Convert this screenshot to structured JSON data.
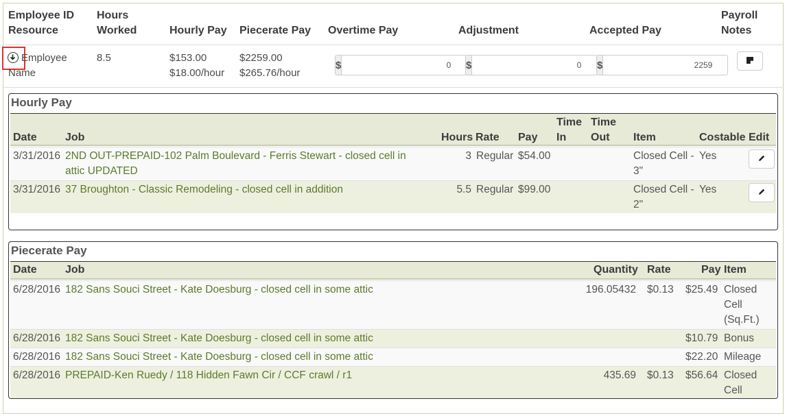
{
  "summary": {
    "headers": {
      "employee_id": "Employee ID",
      "resource": "Resource",
      "hours": "Hours",
      "worked": "Worked",
      "hourly_pay": "Hourly Pay",
      "piecerate_pay": "Piecerate Pay",
      "overtime_pay": "Overtime Pay",
      "adjustment": "Adjustment",
      "accepted_pay": "Accepted Pay",
      "payroll": "Payroll",
      "notes": "Notes"
    },
    "row": {
      "employee_line1": "Employee",
      "employee_line2": "Name",
      "hours_worked": "8.5",
      "hourly_total": "$153.00",
      "hourly_rate": "$18.00/hour",
      "piecerate_total": "$2259.00",
      "piecerate_rate": "$265.76/hour",
      "currency_symbol": "$",
      "overtime_value": "0",
      "adjustment_value": "0",
      "accepted_value": "2259"
    },
    "icons": {
      "expand": "circle-arrow-down-icon",
      "notes": "note-icon"
    }
  },
  "hourly_pay": {
    "title": "Hourly Pay",
    "headers": {
      "date": "Date",
      "job": "Job",
      "hours": "Hours",
      "rate": "Rate",
      "pay": "Pay",
      "time_in_1": "Time",
      "time_in_2": "In",
      "time_out_1": "Time",
      "time_out_2": "Out",
      "item": "Item",
      "costable": "Costable",
      "edit": "Edit"
    },
    "rows": [
      {
        "date": "3/31/2016",
        "job_line1": "2ND OUT-PREPAID-102 Palm Boulevard - Ferris Stewart - closed cell in",
        "job_line2": "attic UPDATED",
        "hours": "3",
        "rate": "Regular",
        "pay": "$54.00",
        "item_line1": "Closed Cell -",
        "item_line2": "3\"",
        "costable": "Yes"
      },
      {
        "date": "3/31/2016",
        "job_line1": "37 Broughton - Classic Remodeling - closed cell in addition",
        "job_line2": "",
        "hours": "5.5",
        "rate": "Regular",
        "pay": "$99.00",
        "item_line1": "Closed Cell -",
        "item_line2": "2\"",
        "costable": "Yes"
      }
    ],
    "edit_icon": "pencil-icon"
  },
  "piecerate_pay": {
    "title": "Piecerate Pay",
    "headers": {
      "date": "Date",
      "job": "Job",
      "quantity": "Quantity",
      "rate": "Rate",
      "pay": "Pay",
      "item": "Item"
    },
    "rows": [
      {
        "date": "6/28/2016",
        "job": "182 Sans Souci Street - Kate Doesburg - closed cell in some attic",
        "quantity": "196.05432",
        "rate": "$0.13",
        "pay": "$25.49",
        "item_line1": "Closed",
        "item_line2": "Cell",
        "item_line3": "(Sq.Ft.)"
      },
      {
        "date": "6/28/2016",
        "job": "182 Sans Souci Street - Kate Doesburg - closed cell in some attic",
        "quantity": "",
        "rate": "",
        "pay": "$10.79",
        "item_line1": "Bonus"
      },
      {
        "date": "6/28/2016",
        "job": "182 Sans Souci Street - Kate Doesburg - closed cell in some attic",
        "quantity": "",
        "rate": "",
        "pay": "$22.20",
        "item_line1": "Mileage"
      },
      {
        "date": "6/28/2016",
        "job": "PREPAID-Ken Ruedy / 118 Hidden Fawn Cir / CCF crawl / r1",
        "quantity": "435.69",
        "rate": "$0.13",
        "pay": "$56.64",
        "item_line1": "Closed",
        "item_line2": "Cell"
      }
    ]
  }
}
